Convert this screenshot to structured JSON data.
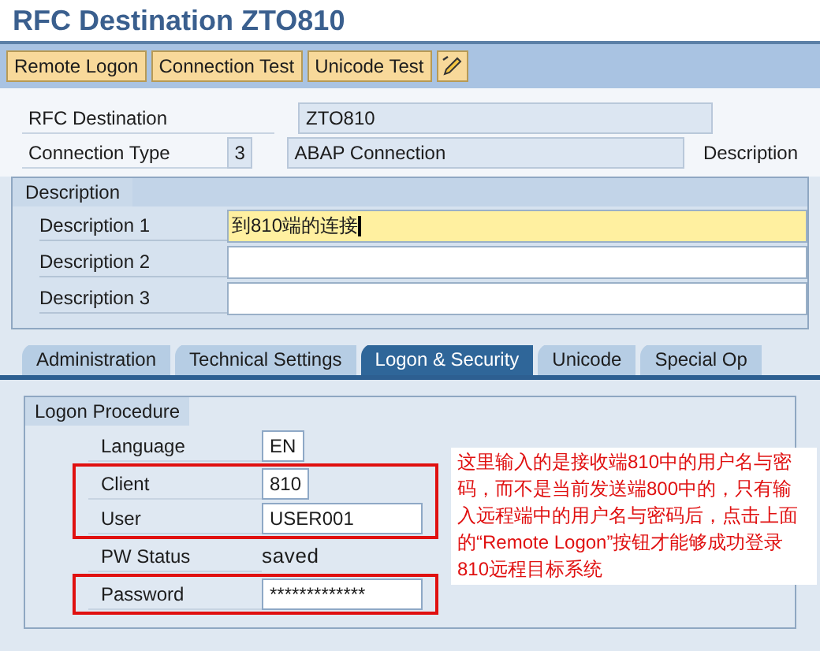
{
  "title": "RFC Destination ZTO810",
  "toolbar": [
    {
      "label": "Remote Logon",
      "kind": "text"
    },
    {
      "label": "Connection Test",
      "kind": "text"
    },
    {
      "label": "Unicode Test",
      "kind": "text"
    },
    {
      "kind": "icon"
    }
  ],
  "header_fields": {
    "rfc_destination": {
      "label": "RFC Destination",
      "value": "ZTO810"
    },
    "connection_type": {
      "label": "Connection Type",
      "code": "3",
      "value": "ABAP Connection",
      "trailing_label": "Description"
    }
  },
  "description_group": {
    "title": "Description",
    "rows": [
      {
        "label": "Description 1",
        "value": "到810端的连接",
        "focused": true
      },
      {
        "label": "Description 2",
        "value": "",
        "focused": false
      },
      {
        "label": "Description 3",
        "value": "",
        "focused": false
      }
    ]
  },
  "tabs": [
    {
      "label": "Administration",
      "selected": false
    },
    {
      "label": "Technical Settings",
      "selected": false
    },
    {
      "label": "Logon & Security",
      "selected": true
    },
    {
      "label": "Unicode",
      "selected": false
    },
    {
      "label": "Special Op",
      "selected": false
    }
  ],
  "logon_group": {
    "title": "Logon Procedure",
    "rows": [
      {
        "label": "Language",
        "value": "EN",
        "kind": "short",
        "highlighted": false
      },
      {
        "label": "Client",
        "value": "810",
        "kind": "short",
        "highlighted": true
      },
      {
        "label": "User",
        "value": "USER001",
        "kind": "input",
        "highlighted": true
      },
      {
        "label": "PW Status",
        "value": "saved",
        "kind": "display",
        "highlighted": false
      },
      {
        "label": "Password",
        "value": "*************",
        "kind": "input",
        "highlighted": true
      }
    ]
  },
  "annotation": "这里输入的是接收端810中的用户名与密码，而不是当前发送端800中的，只有输入远程端中的用户名与密码后，点击上面的“Remote Logon”按钮才能够成功登录810远程目标系统"
}
